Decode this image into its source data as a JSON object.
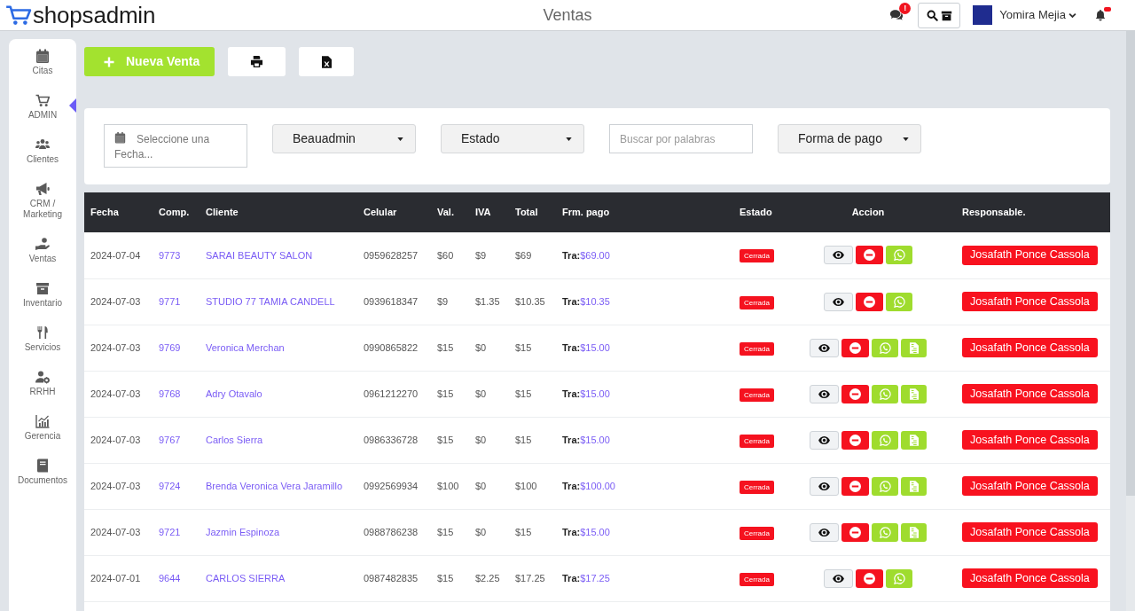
{
  "header": {
    "logo_text": "shopsadmin",
    "title": "Ventas",
    "chat_badge": "!",
    "user_name": "Yomira Mejia"
  },
  "sidebar": {
    "items": [
      {
        "label": "Citas",
        "selected": false
      },
      {
        "label": "ADMIN",
        "selected": true
      },
      {
        "label": "Clientes",
        "selected": false
      },
      {
        "label": "CRM / Marketing",
        "selected": false
      },
      {
        "label": "Ventas",
        "selected": false
      },
      {
        "label": "Inventario",
        "selected": false
      },
      {
        "label": "Servicios",
        "selected": false
      },
      {
        "label": "RRHH",
        "selected": false
      },
      {
        "label": "Gerencia",
        "selected": false
      },
      {
        "label": "Documentos",
        "selected": false
      }
    ]
  },
  "toolbar": {
    "new_sale_label": "Nueva Venta"
  },
  "filters": [
    {
      "kind": "date",
      "placeholder": "Seleccione una Fecha..."
    },
    {
      "kind": "dropdown",
      "value": "Beauadmin"
    },
    {
      "kind": "dropdown",
      "value": "Estado"
    },
    {
      "kind": "search",
      "placeholder": "Buscar por palabras"
    },
    {
      "kind": "dropdown",
      "value": "Forma de pago"
    }
  ],
  "table": {
    "columns": [
      "Fecha",
      "Comp.",
      "Cliente",
      "Celular",
      "Val.",
      "IVA",
      "Total",
      "Frm. pago",
      "Estado",
      "Accion",
      "Responsable."
    ],
    "rows": [
      {
        "date": "2024-07-04",
        "receipt": "9773",
        "client": "SARAI BEAUTY SALON",
        "phone": "0959628257",
        "value": "$60",
        "tax": "$9",
        "total": "$69",
        "payment_method": "Tra:",
        "payment_amount": "$69.00",
        "status": "Cerrada",
        "actions": [
          {
            "kind": "view"
          },
          {
            "kind": "delete"
          },
          {
            "kind": "message"
          }
        ],
        "responsible": "Josafath Ponce Cassola"
      },
      {
        "date": "2024-07-03",
        "receipt": "9771",
        "client": "STUDIO 77 TAMIA CANDELL",
        "phone": "0939618347",
        "value": "$9",
        "tax": "$1.35",
        "total": "$10.35",
        "payment_method": "Tra:",
        "payment_amount": "$10.35",
        "status": "Cerrada",
        "actions": [
          {
            "kind": "view"
          },
          {
            "kind": "delete"
          },
          {
            "kind": "message"
          }
        ],
        "responsible": "Josafath Ponce Cassola"
      },
      {
        "date": "2024-07-03",
        "receipt": "9769",
        "client": "Veronica Merchan",
        "phone": "0990865822",
        "value": "$15",
        "tax": "$0",
        "total": "$15",
        "payment_method": "Tra:",
        "payment_amount": "$15.00",
        "status": "Cerrada",
        "actions": [
          {
            "kind": "view"
          },
          {
            "kind": "delete"
          },
          {
            "kind": "message"
          },
          {
            "kind": "document"
          }
        ],
        "responsible": "Josafath Ponce Cassola"
      },
      {
        "date": "2024-07-03",
        "receipt": "9768",
        "client": "Adry Otavalo",
        "phone": "0961212270",
        "value": "$15",
        "tax": "$0",
        "total": "$15",
        "payment_method": "Tra:",
        "payment_amount": "$15.00",
        "status": "Cerrada",
        "actions": [
          {
            "kind": "view"
          },
          {
            "kind": "delete"
          },
          {
            "kind": "message"
          },
          {
            "kind": "document"
          }
        ],
        "responsible": "Josafath Ponce Cassola"
      },
      {
        "date": "2024-07-03",
        "receipt": "9767",
        "client": "Carlos Sierra",
        "phone": "0986336728",
        "value": "$15",
        "tax": "$0",
        "total": "$15",
        "payment_method": "Tra:",
        "payment_amount": "$15.00",
        "status": "Cerrada",
        "actions": [
          {
            "kind": "view"
          },
          {
            "kind": "delete"
          },
          {
            "kind": "message"
          },
          {
            "kind": "document"
          }
        ],
        "responsible": "Josafath Ponce Cassola"
      },
      {
        "date": "2024-07-03",
        "receipt": "9724",
        "client": "Brenda Veronica Vera Jaramillo",
        "phone": "0992569934",
        "value": "$100",
        "tax": "$0",
        "total": "$100",
        "payment_method": "Tra:",
        "payment_amount": "$100.00",
        "status": "Cerrada",
        "actions": [
          {
            "kind": "view"
          },
          {
            "kind": "delete"
          },
          {
            "kind": "message"
          },
          {
            "kind": "document"
          }
        ],
        "responsible": "Josafath Ponce Cassola"
      },
      {
        "date": "2024-07-03",
        "receipt": "9721",
        "client": "Jazmin Espinoza",
        "phone": "0988786238",
        "value": "$15",
        "tax": "$0",
        "total": "$15",
        "payment_method": "Tra:",
        "payment_amount": "$15.00",
        "status": "Cerrada",
        "actions": [
          {
            "kind": "view"
          },
          {
            "kind": "delete"
          },
          {
            "kind": "message"
          },
          {
            "kind": "document"
          }
        ],
        "responsible": "Josafath Ponce Cassola"
      },
      {
        "date": "2024-07-01",
        "receipt": "9644",
        "client": "CARLOS SIERRA",
        "phone": "0987482835",
        "value": "$15",
        "tax": "$2.25",
        "total": "$17.25",
        "payment_method": "Tra:",
        "payment_amount": "$17.25",
        "status": "Cerrada",
        "actions": [
          {
            "kind": "view"
          },
          {
            "kind": "delete"
          },
          {
            "kind": "message"
          }
        ],
        "responsible": "Josafath Ponce Cassola"
      }
    ]
  }
}
